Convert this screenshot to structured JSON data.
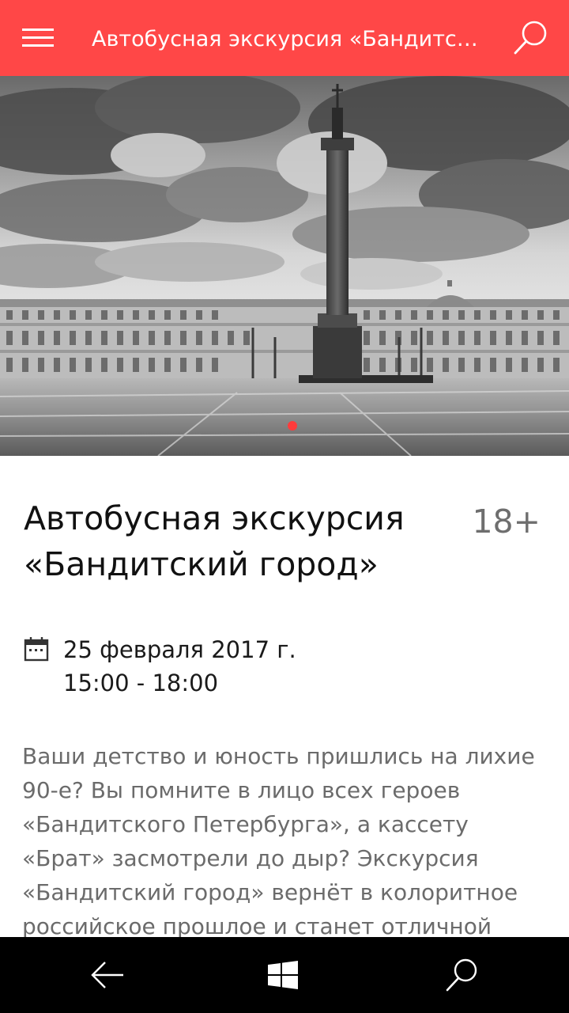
{
  "app_bar": {
    "title": "Автобусная экскурсия «Бандитск…",
    "menu_icon": "hamburger-menu-icon",
    "search_icon": "search-icon",
    "background": "#ff4747"
  },
  "hero": {
    "image": "black-and-white photo of Palace Square with the Alexander Column",
    "pager": {
      "page_count": 1,
      "current": 1,
      "dot_color": "#ff3b3b"
    }
  },
  "event": {
    "title": "Автобусная экскурсия «Бандитский город»",
    "age_rating": "18+",
    "date_icon": "calendar-icon",
    "date": "25 февраля 2017 г.",
    "time": "15:00 - 18:00",
    "description": "Ваши детство и юность пришлись на лихие 90-е? Вы помните в лицо всех героев «Бандитского Петербурга», а кассету «Брат» засмотрели до дыр? Экскурсия «Бандитский город» вернёт в колоритное российское прошлое и станет отличной прививкой от"
  },
  "nav_bar": {
    "back_icon": "back-arrow-icon",
    "home_icon": "windows-logo-icon",
    "search_icon": "search-icon"
  }
}
